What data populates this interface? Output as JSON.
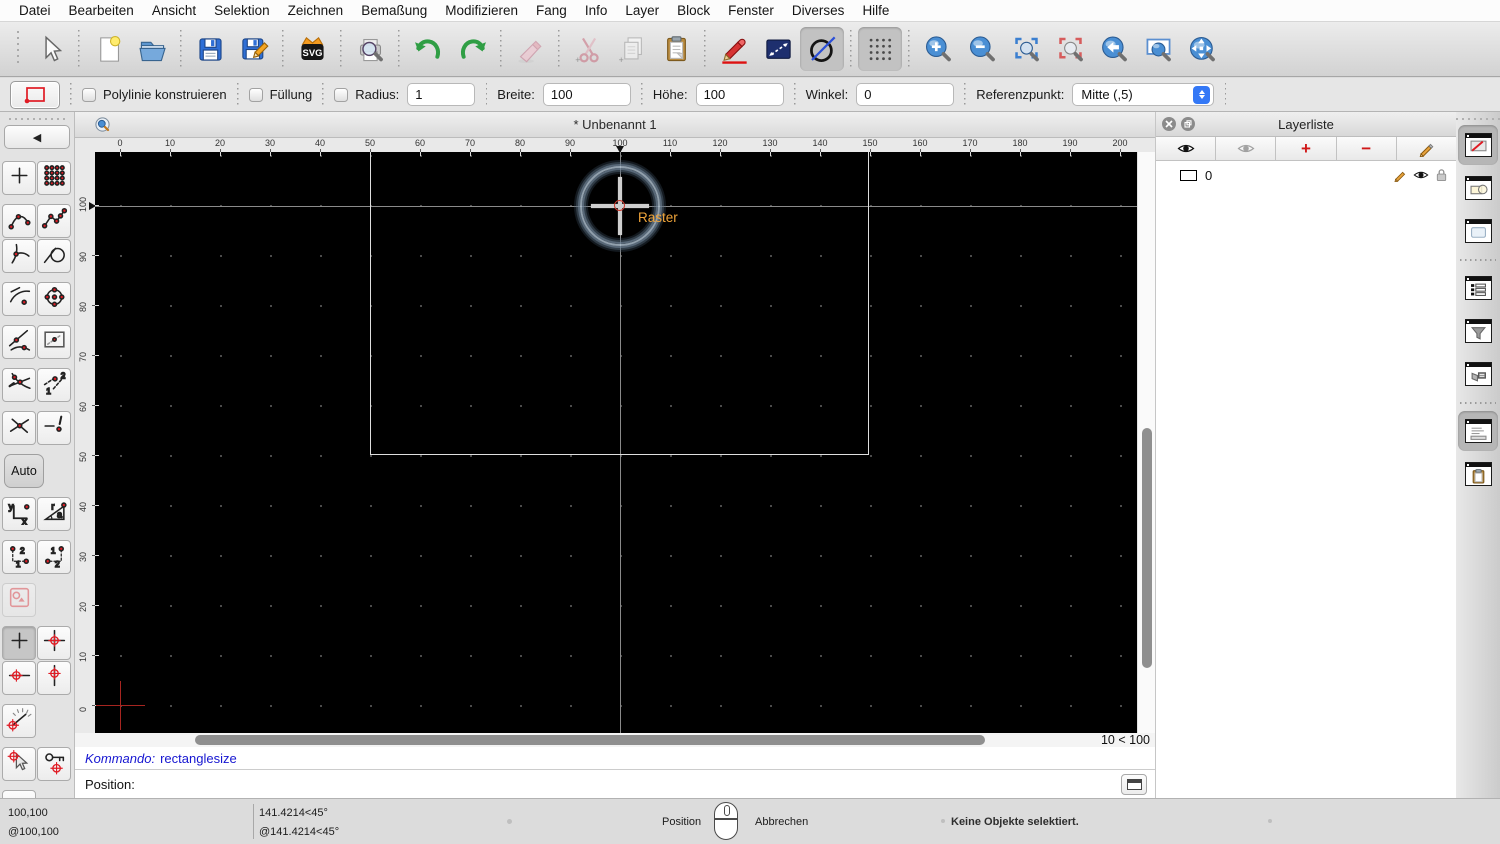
{
  "menu_bar": {
    "items": [
      "Datei",
      "Bearbeiten",
      "Ansicht",
      "Selektion",
      "Zeichnen",
      "Bemaßung",
      "Modifizieren",
      "Fang",
      "Info",
      "Layer",
      "Block",
      "Fenster",
      "Diverses",
      "Hilfe"
    ]
  },
  "toolbar": {
    "groups": [
      [
        "selection-cursor"
      ],
      [
        "new-file",
        "open-file"
      ],
      [
        "save-file",
        "save-file-as"
      ],
      [
        "svg-export"
      ],
      [
        "print-preview"
      ],
      [
        "undo",
        "redo"
      ],
      [
        "delete-entities"
      ],
      [
        "cut",
        "copy",
        "paste"
      ],
      [
        "draw-pencil",
        "dimension-tool",
        "circle-two-point"
      ],
      [
        "grid-toggle"
      ],
      [
        "zoom-in",
        "zoom-out",
        "auto-zoom",
        "zoom-selection",
        "previous-view",
        "zoom-window",
        "pan"
      ]
    ],
    "selected": [
      "circle-two-point",
      "grid-toggle"
    ],
    "disabled": [
      "delete-entities",
      "cut",
      "copy"
    ]
  },
  "options_bar": {
    "polyline_label": "Polylinie konstruieren",
    "fill_label": "Füllung",
    "radius_label": "Radius:",
    "radius_value": "1",
    "width_label": "Breite:",
    "width_value": "100",
    "height_label": "Höhe:",
    "height_value": "100",
    "angle_label": "Winkel:",
    "angle_value": "0",
    "refpoint_label": "Referenzpunkt:",
    "refpoint_value": "Mitte (,5)"
  },
  "left_panel": {
    "auto_label": "Auto",
    "rows": [
      [
        {
          "n": "snap-free"
        },
        {
          "n": "snap-grid"
        }
      ],
      [
        {
          "n": "snap-endpoints"
        },
        {
          "n": "snap-on-entity"
        },
        {
          "grp": true
        }
      ],
      [
        {
          "n": "snap-perpendicular"
        },
        {
          "n": "snap-tangential"
        }
      ],
      [
        {
          "n": "snap-reference"
        },
        {
          "n": "snap-center"
        },
        {
          "grp": true
        }
      ],
      [
        {
          "n": "snap-middle"
        },
        {
          "n": "snap-entity-range"
        },
        {
          "grp": true
        }
      ],
      [
        {
          "n": "snap-intersection"
        },
        {
          "n": "snap-intersection-manual"
        },
        {
          "grp": true
        }
      ],
      [
        {
          "n": "snap-auto"
        },
        {
          "n": "snap-distance"
        },
        {
          "grp": true
        }
      ],
      [
        {
          "n": "coordinate-cartesian"
        },
        {
          "n": "coordinate-polar"
        },
        {
          "grp": true
        }
      ],
      [
        {
          "n": "relative-cartesian"
        },
        {
          "n": "relative-polar"
        },
        {
          "grp": true
        }
      ],
      [
        {
          "n": "restrict-disabled",
          "faded": true
        },
        {
          "grp": true
        }
      ],
      [
        {
          "n": "restrict-none",
          "sel": true
        },
        {
          "n": "snap-crosshair"
        },
        {
          "grp": true
        }
      ],
      [
        {
          "n": "restrict-horizontal"
        },
        {
          "n": "restrict-vertical"
        }
      ],
      [
        {
          "n": "restrict-angle"
        },
        {
          "grp": true
        }
      ],
      [
        {
          "n": "snap-cursor"
        },
        {
          "n": "snap-coordinate"
        },
        {
          "grp": true
        }
      ],
      [
        {
          "n": "snap-keyboard"
        },
        {
          "grp": true
        }
      ]
    ]
  },
  "document": {
    "title": "* Unbenannt 1",
    "h_ruler_ticks": [
      0,
      10,
      20,
      30,
      40,
      50,
      60,
      70,
      80,
      90,
      100,
      110,
      120,
      130,
      140,
      150,
      160,
      170,
      180,
      190,
      200
    ],
    "v_ruler_ticks": [
      100,
      90,
      80,
      70,
      60,
      50,
      40,
      30,
      20,
      10,
      0
    ],
    "snap_label": "Raster",
    "grid_info": "10 < 100"
  },
  "command_line": {
    "history_label": "Kommando:",
    "history_value": "rectanglesize",
    "prompt": "Position:"
  },
  "layer_panel": {
    "title": "Layerliste",
    "layers": [
      {
        "name": "0"
      }
    ]
  },
  "dock": {
    "items": [
      {
        "n": "layer-list",
        "sel": true
      },
      {
        "n": "block-list"
      },
      {
        "n": "library-browser"
      },
      {
        "sep": true
      },
      {
        "n": "property-editor"
      },
      {
        "n": "selection-filter"
      },
      {
        "n": "view-list"
      },
      {
        "sep": true
      },
      {
        "n": "command-line-panel",
        "sel": true
      },
      {
        "n": "clipboard-panel"
      }
    ]
  },
  "status_bar": {
    "abs_coord": "100,100",
    "rel_coord": "@100,100",
    "abs_polar": "141.4214<45°",
    "rel_polar": "@141.4214<45°",
    "left_button_label": "Position",
    "right_button_label": "Abbrechen",
    "selection_status": "Keine Objekte selektiert."
  },
  "icon_glyphs": {
    "svg": "SVG",
    "plus": "+",
    "one": "1",
    "two": "2",
    "x": "x",
    "y": "y",
    "r": "r",
    "a": "a",
    "back": "◀"
  },
  "colors": {
    "accent_blue": "#3478f6",
    "tool_red": "#e01b24",
    "canvas_bg": "#000000",
    "snap_label_orange": "#efa43a",
    "command_blue": "#1616d1",
    "green_arrow": "#2f9e44"
  }
}
